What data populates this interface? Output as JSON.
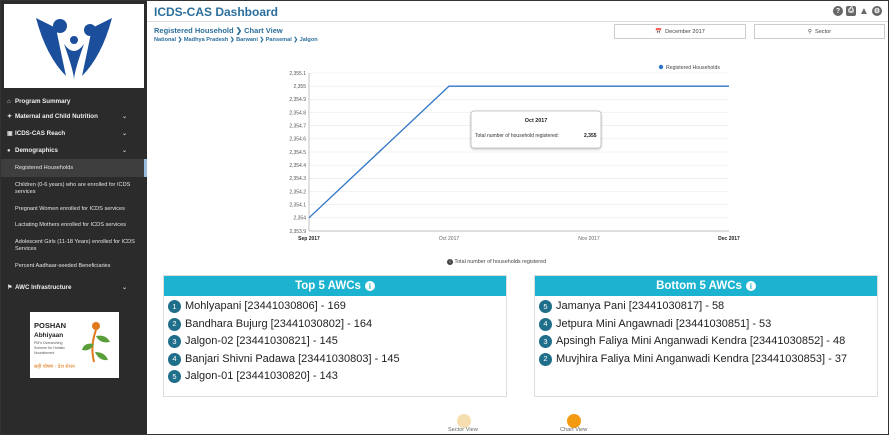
{
  "header": {
    "title": "ICDS-CAS Dashboard",
    "icons": [
      "help-icon",
      "print-icon",
      "alert-icon",
      "settings-icon"
    ]
  },
  "page": {
    "subtitle_prefix": "Registered Household",
    "subtitle_suffix": "Chart View",
    "breadcrumbs": [
      "National",
      "Madhya Pradesh",
      "Barwani",
      "Pansemal",
      "Jalgon"
    ]
  },
  "filters": {
    "date": "December 2017",
    "level": "Sector"
  },
  "sidebar": {
    "items": [
      {
        "label": "Program Summary",
        "icon": "home-icon",
        "expandable": false
      },
      {
        "label": "Maternal and Child Nutrition",
        "icon": "nutrition-icon",
        "expandable": true
      },
      {
        "label": "ICDS-CAS Reach",
        "icon": "reach-icon",
        "expandable": true
      },
      {
        "label": "Demographics",
        "icon": "demographics-icon",
        "expandable": true
      }
    ],
    "sub_items": [
      "Registered Households",
      "Children (0-6 years) who are enrolled for ICDS services",
      "Pregnant Women enrolled for ICDS services",
      "Lactating Mothers enrolled for ICDS services",
      "Adolescent Girls (11-18 Years) enrolled for ICDS Services",
      "Percent Aadhaar-seeded Beneficiaries"
    ],
    "infra": {
      "label": "AWC Infrastructure",
      "icon": "infrastructure-icon"
    },
    "poshan": {
      "title1": "POSHAN",
      "title2": "Abhiyaan",
      "tagline1": "PM's Overarching",
      "tagline2": "Scheme for Holistic",
      "tagline3": "Nourishment",
      "slogan": "सही पोषण - देश रोशन"
    }
  },
  "chart_data": {
    "type": "line",
    "legend": "Registered Households",
    "legend_position": "top-right",
    "x": [
      "Sep 2017",
      "Oct 2017",
      "Nov 2017",
      "Dec 2017"
    ],
    "series": [
      {
        "name": "Registered Households",
        "values": [
          2354,
          2355,
          2355,
          2355
        ]
      }
    ],
    "ylim": [
      2353.9,
      2355.1
    ],
    "yticks": [
      "2,353.9",
      "2,354",
      "2,354.1",
      "2,354.2",
      "2,354.3",
      "2,354.4",
      "2,354.5",
      "2,354.6",
      "2,354.7",
      "2,354.8",
      "2,354.9",
      "2,355",
      "2,355.1"
    ],
    "grid": true,
    "tooltip": {
      "title": "Oct 2017",
      "label": "Total number of household registered:",
      "value": "2,355"
    },
    "caption": "Total number of households registered",
    "line_color": "#2e75c8"
  },
  "top_awcs": {
    "title": "Top 5 AWCs",
    "items": [
      {
        "rank": "1",
        "text": "Mohlyapani [23441030806] - 169"
      },
      {
        "rank": "2",
        "text": "Bandhara Bujurg [23441030802] - 164"
      },
      {
        "rank": "3",
        "text": "Jalgon-02 [23441030821] - 145"
      },
      {
        "rank": "4",
        "text": "Banjari Shivni Padawa [23441030803] - 145"
      },
      {
        "rank": "5",
        "text": "Jalgon-01 [23441030820] - 143"
      }
    ]
  },
  "bottom_awcs": {
    "title": "Bottom 5 AWCs",
    "items": [
      {
        "rank": "5",
        "text": "Jamanya Pani [23441030817] - 58"
      },
      {
        "rank": "4",
        "text": "Jetpura Mini Angawnadi [23441030851] - 53"
      },
      {
        "rank": "3",
        "text": "Apsingh Faliya Mini Anganwadi Kendra [23441030852] - 48"
      },
      {
        "rank": "2",
        "text": "Muvjhira Faliya Mini Anganwadi Kendra [23441030853] - 37"
      }
    ]
  },
  "view_toggle": {
    "sector_label": "Sector View",
    "chart_label": "Chart View",
    "inactive_color": "#f5deb0",
    "active_color": "#f39a12"
  },
  "colors": {
    "accent": "#2b6f9c",
    "panel_header": "#1bb3d0",
    "rank_badge": "#1f6f8b",
    "sidebar_bg": "#2b2b2b"
  }
}
